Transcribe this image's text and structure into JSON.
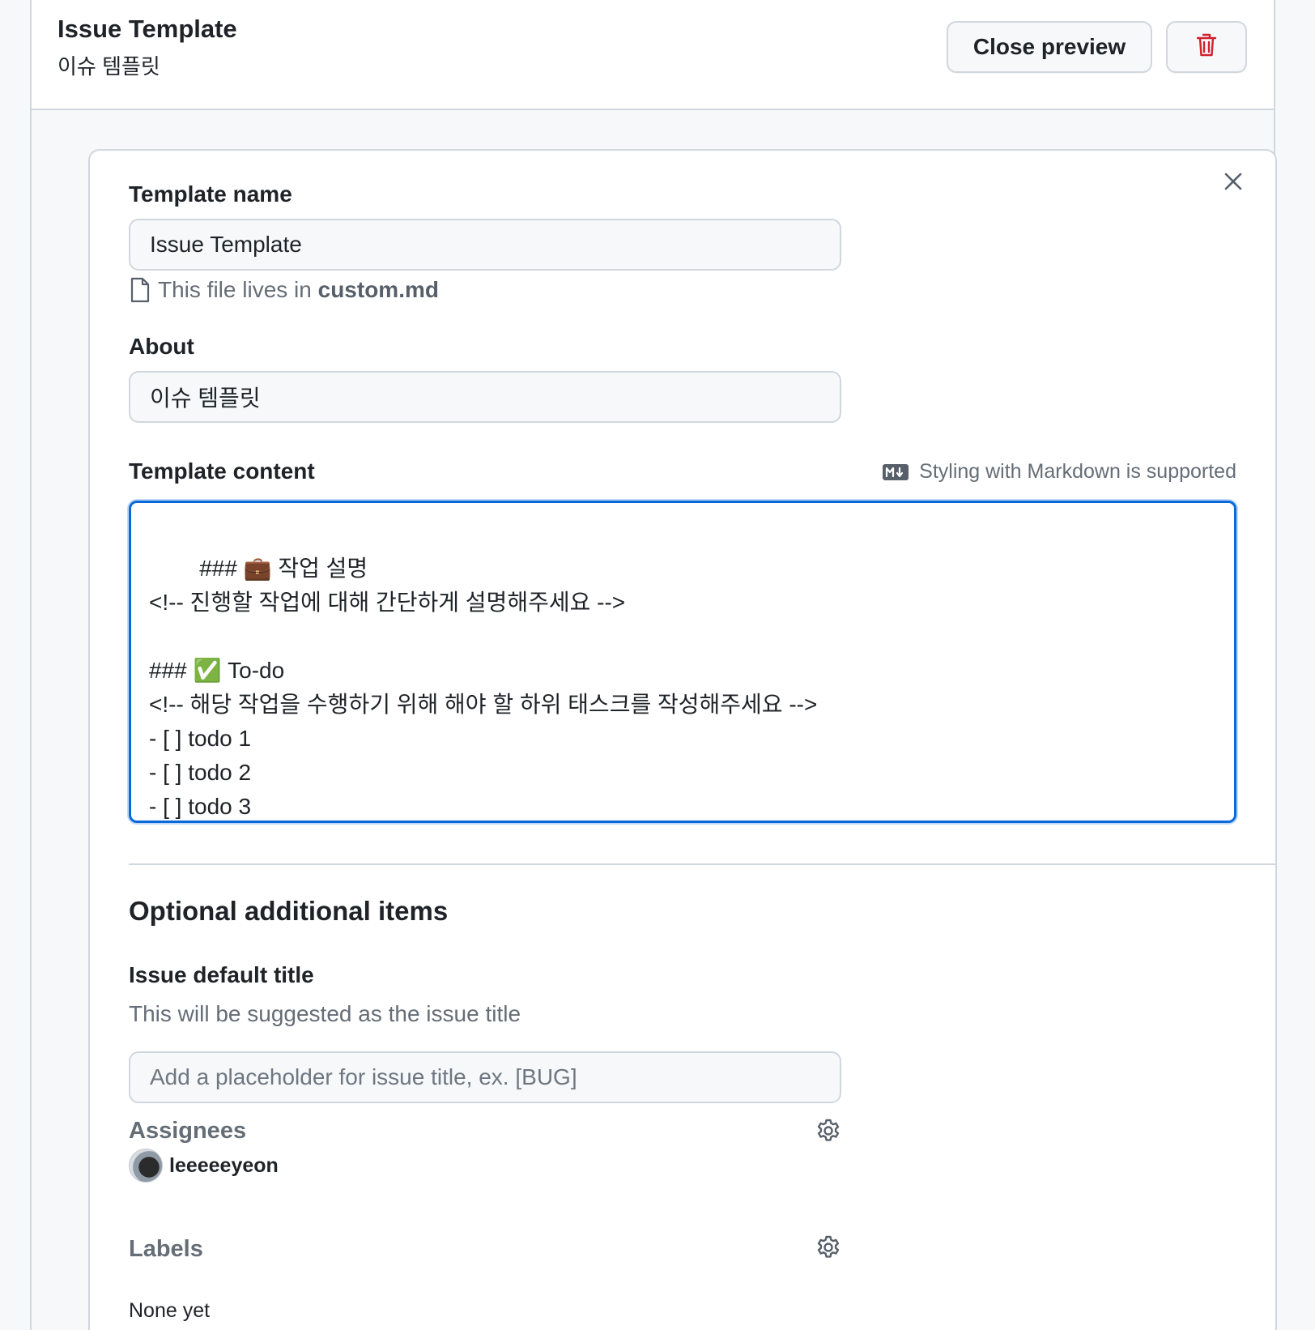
{
  "header": {
    "title": "Issue Template",
    "subtitle": "이슈 템플릿",
    "close_preview_label": "Close preview",
    "delete_icon": "trash-icon",
    "delete_color": "#cf222e"
  },
  "form": {
    "template_name": {
      "label": "Template name",
      "value": "Issue Template",
      "file_hint_prefix": "This file lives in ",
      "file_name": "custom.md"
    },
    "about": {
      "label": "About",
      "value": "이슈 템플릿"
    },
    "template_content": {
      "label": "Template content",
      "markdown_hint": "Styling with Markdown is supported",
      "value": "### 💼 작업 설명\n<!-- 진행할 작업에 대해 간단하게 설명해주세요 -->\n\n### ✅ To-do\n<!-- 해당 작업을 수행하기 위해 해야 할 하위 태스크를 작성해주세요 -->\n- [ ] todo 1\n- [ ] todo 2\n- [ ] todo 3"
    },
    "optional": {
      "section_title": "Optional additional items",
      "issue_default_title": {
        "label": "Issue default title",
        "description": "This will be suggested as the issue title",
        "placeholder": "Add a placeholder for issue title, ex. [BUG]",
        "value": ""
      },
      "assignees": {
        "label": "Assignees",
        "users": [
          "leeeeeyeon"
        ]
      },
      "labels": {
        "label": "Labels",
        "empty_text": "None yet"
      }
    }
  },
  "colors": {
    "accent": "#0969da",
    "border": "#d0d7de",
    "muted": "#656d76",
    "danger": "#cf222e"
  }
}
